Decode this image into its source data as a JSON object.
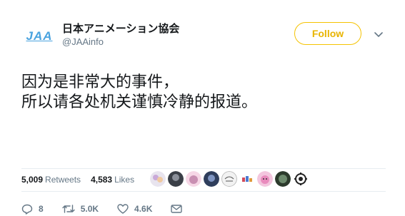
{
  "account": {
    "avatar_text": "JAA",
    "display_name": "日本アニメーション協会",
    "handle": "@JAAinfo"
  },
  "follow_label": "Follow",
  "tweet": {
    "line1": "因为是非常大的事件，",
    "line2": "所以请各处机关谨慎冷静的报道。"
  },
  "stats": {
    "retweets_count": "5,009",
    "retweets_label": "Retweets",
    "likes_count": "4,583",
    "likes_label": "Likes"
  },
  "liker_avatars": [
    "avatar-1",
    "avatar-2",
    "avatar-3",
    "avatar-4",
    "avatar-5",
    "avatar-6",
    "avatar-7",
    "avatar-8",
    "avatar-9"
  ],
  "actions": {
    "reply_count": "8",
    "retweet_count": "5.0K",
    "like_count": "4.6K"
  },
  "colors": {
    "follow_accent": "#f5c300",
    "avatar_blue": "#4aa3df",
    "muted": "#657786"
  }
}
